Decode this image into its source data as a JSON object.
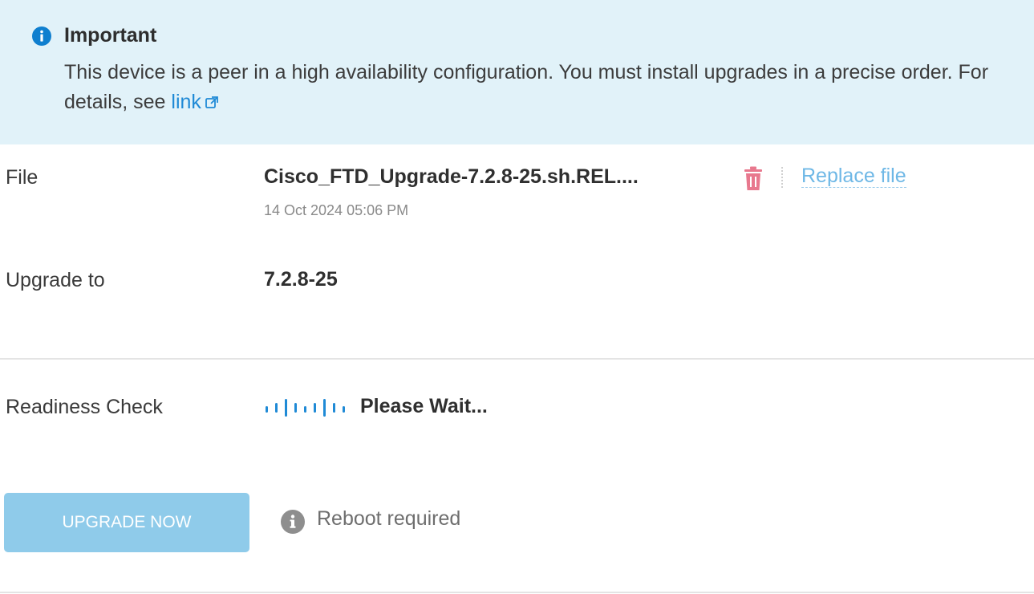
{
  "banner": {
    "title": "Important",
    "message": "This device is a peer in a high availability configuration. You must install upgrades in a precise order. For details, see ",
    "link_text": "link",
    "background_color": "#e1f2f9",
    "icon": "info-icon"
  },
  "file_row": {
    "label": "File",
    "file_name": "Cisco_FTD_Upgrade-7.2.8-25.sh.REL....",
    "timestamp": "14 Oct 2024 05:06 PM",
    "delete_icon": "trash-icon",
    "replace_label": "Replace file"
  },
  "upgrade_row": {
    "label": "Upgrade to",
    "version": "7.2.8-25"
  },
  "readiness_row": {
    "label": "Readiness Check",
    "status": "Please Wait...",
    "spinner_icon": "cisco-loading-icon"
  },
  "actions": {
    "upgrade_button_label": "UPGRADE NOW",
    "reboot_note": "Reboot required",
    "button_color": "#8fcbea"
  },
  "colors": {
    "accent": "#1f8ad6",
    "danger": "#e8788e"
  }
}
